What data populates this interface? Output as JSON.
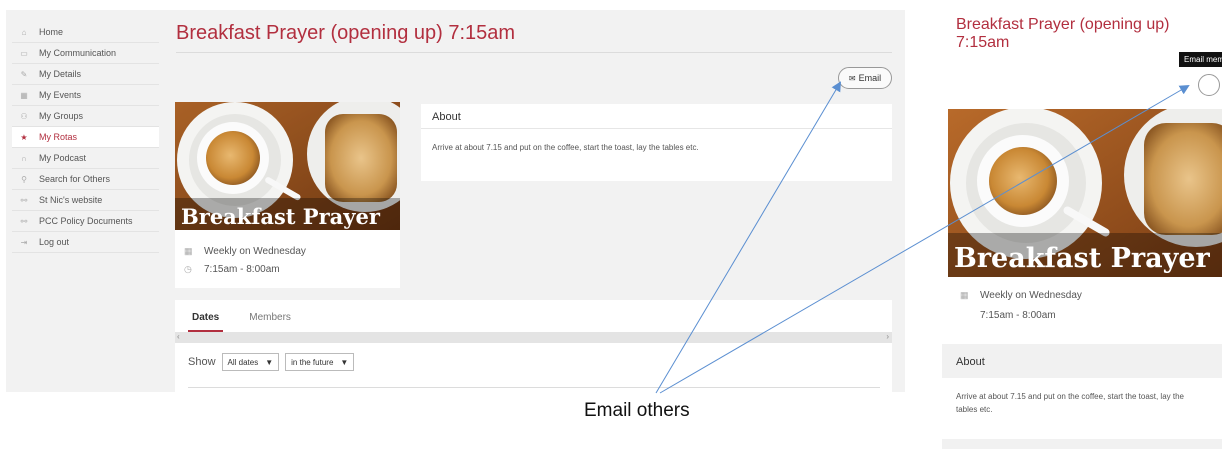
{
  "sidebar": {
    "items": [
      {
        "label": "Home",
        "icon": "home-icon",
        "glyph": "⌂"
      },
      {
        "label": "My Communication",
        "icon": "message-icon",
        "glyph": "▭"
      },
      {
        "label": "My Details",
        "icon": "pencil-icon",
        "glyph": "✎"
      },
      {
        "label": "My Events",
        "icon": "calendar-icon",
        "glyph": "▦"
      },
      {
        "label": "My Groups",
        "icon": "group-icon",
        "glyph": "⚇"
      },
      {
        "label": "My Rotas",
        "icon": "star-icon",
        "glyph": "★"
      },
      {
        "label": "My Podcast",
        "icon": "headphones-icon",
        "glyph": "∩"
      },
      {
        "label": "Search for Others",
        "icon": "people-search-icon",
        "glyph": "⚲"
      },
      {
        "label": "St Nic's website",
        "icon": "link-icon",
        "glyph": "⚯"
      },
      {
        "label": "PCC Policy Documents",
        "icon": "link-icon",
        "glyph": "⚯"
      },
      {
        "label": "Log out",
        "icon": "logout-icon",
        "glyph": "⇥"
      }
    ],
    "active_index": 5
  },
  "event": {
    "title": "Breakfast Prayer (opening up) 7:15am",
    "image_caption": "Breakfast Prayer",
    "schedule": "Weekly on Wednesday",
    "time": "7:15am - 8:00am",
    "email_label": "Email",
    "about_heading": "About",
    "about_text": "Arrive at about 7.15 and put on the coffee, start the toast, lay the tables etc."
  },
  "tabs": [
    "Dates",
    "Members"
  ],
  "filters": {
    "show_label": "Show",
    "dates_select": "All dates",
    "range_select": "in the future"
  },
  "zoom": {
    "title": "Breakfast Prayer (opening up) 7:15am",
    "tooltip": "Email members"
  },
  "annotation": {
    "text": "Email others"
  },
  "colors": {
    "accent": "#b22f3f",
    "arrow": "#5b8fd1",
    "page_bg": "#f2f2f2"
  },
  "icons": {
    "calendar": "▦",
    "clock": "◷",
    "envelope": "✉",
    "caret": "▼",
    "scroll_left": "‹",
    "scroll_right": "›"
  }
}
